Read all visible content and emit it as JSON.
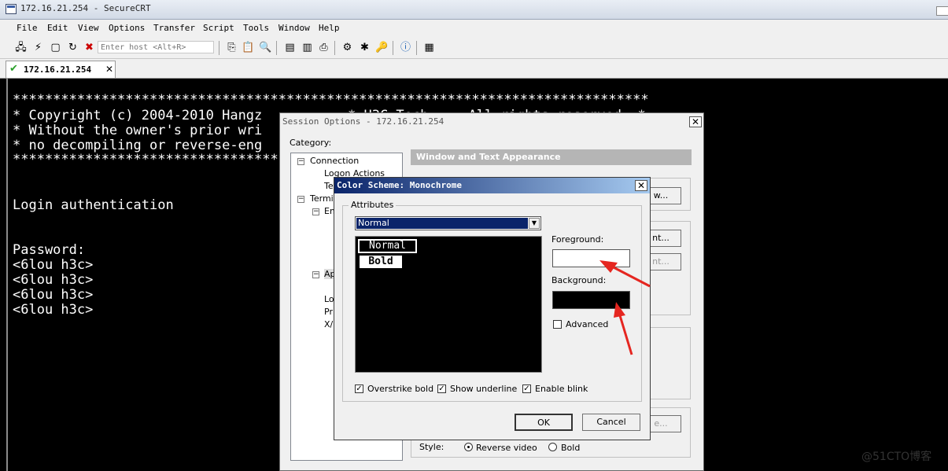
{
  "window": {
    "title": "172.16.21.254 - SecureCRT"
  },
  "menu": [
    "File",
    "Edit",
    "View",
    "Options",
    "Transfer",
    "Script",
    "Tools",
    "Window",
    "Help"
  ],
  "toolbar": {
    "host_placeholder": "Enter host <Alt+R>"
  },
  "tab": {
    "label": "172.16.21.254",
    "close": "✕"
  },
  "terminal": {
    "lines": [
      "*******************************************************************************",
      "* Copyright (c) 2004-2010 Hangz",
      "* Without the owner's prior wri",
      "* no decompiling or reverse-eng",
      "*************************************",
      "Login authentication",
      "Password:",
      "<6lou h3c>",
      "<6lou h3c>",
      "<6lou h3c>",
      "<6lou h3c>"
    ],
    "fragment_line2": "* H3C Tech...  All rights reserved. *"
  },
  "session_options": {
    "title": "Session Options - 172.16.21.254",
    "category_label": "Category:",
    "panel_header": "Window and Text Appearance",
    "tree": {
      "connection": "Connection",
      "logon_actions": "Logon Actions",
      "te": "Te",
      "terminal": "Termi",
      "em": "Em",
      "ap": "Ap",
      "lo": "Lo",
      "pr": "Pr",
      "x": "X/"
    },
    "right_buttons": {
      "b1": "w...",
      "b2": "nt...",
      "b3": "nt...",
      "b4": "e..."
    },
    "style_label": "Style:",
    "reverse_video": "Reverse video",
    "bold": "Bold"
  },
  "color_scheme": {
    "title": "Color Scheme: Monochrome",
    "attributes_label": "Attributes",
    "selected_attribute": "Normal",
    "preview": {
      "normal": "Normal",
      "bold": "Bold"
    },
    "foreground_label": "Foreground:",
    "background_label": "Background:",
    "foreground_color": "#ffffff",
    "background_color": "#000000",
    "advanced": "Advanced",
    "overstrike_bold": "Overstrike bold",
    "show_underline": "Show underline",
    "enable_blink": "Enable blink",
    "ok": "OK",
    "cancel": "Cancel"
  },
  "watermark": "@51CTO博客"
}
